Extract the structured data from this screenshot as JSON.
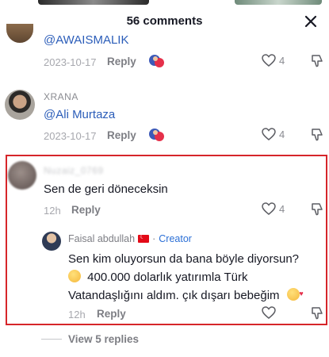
{
  "header": {
    "title": "56 comments",
    "close_icon": "close-icon"
  },
  "comments": [
    {
      "mention": "@AWAISMALIK",
      "date": "2023-10-17",
      "reply_label": "Reply",
      "likes": "4"
    },
    {
      "username": "XRANA",
      "mention": "@Ali Murtaza",
      "date": "2023-10-17",
      "reply_label": "Reply",
      "likes": "4"
    },
    {
      "username": "Nuzaiz_0769",
      "text": "Sen de geri döneceksin",
      "date": "12h",
      "reply_label": "Reply",
      "likes": "4"
    }
  ],
  "reply": {
    "username": "Faisal abdullah",
    "separator": "·",
    "badge": "Creator",
    "line1": "Sen kim oluyorsun da bana böyle diyorsun?",
    "line2": "400.000 dolarlık yatırımla Türk",
    "line3": "Vatandaşlığını aldım. çık dışarı bebeğim",
    "date": "12h",
    "reply_label": "Reply"
  },
  "view_replies": "View 5 replies",
  "colors": {
    "highlight": "#d6252a",
    "mention": "#2b5db9",
    "creator": "#2b6fd6"
  }
}
